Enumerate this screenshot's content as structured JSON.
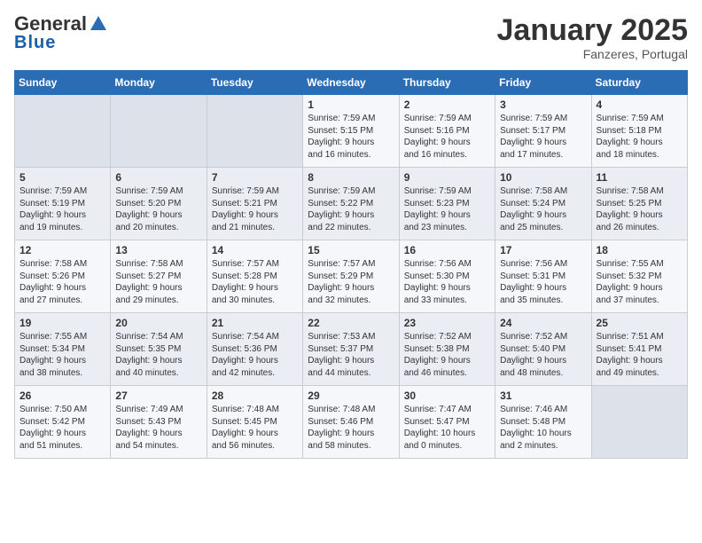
{
  "header": {
    "logo_general": "General",
    "logo_blue": "Blue",
    "month": "January 2025",
    "location": "Fanzeres, Portugal"
  },
  "weekdays": [
    "Sunday",
    "Monday",
    "Tuesday",
    "Wednesday",
    "Thursday",
    "Friday",
    "Saturday"
  ],
  "weeks": [
    [
      {
        "day": "",
        "info": ""
      },
      {
        "day": "",
        "info": ""
      },
      {
        "day": "",
        "info": ""
      },
      {
        "day": "1",
        "info": "Sunrise: 7:59 AM\nSunset: 5:15 PM\nDaylight: 9 hours\nand 16 minutes."
      },
      {
        "day": "2",
        "info": "Sunrise: 7:59 AM\nSunset: 5:16 PM\nDaylight: 9 hours\nand 16 minutes."
      },
      {
        "day": "3",
        "info": "Sunrise: 7:59 AM\nSunset: 5:17 PM\nDaylight: 9 hours\nand 17 minutes."
      },
      {
        "day": "4",
        "info": "Sunrise: 7:59 AM\nSunset: 5:18 PM\nDaylight: 9 hours\nand 18 minutes."
      }
    ],
    [
      {
        "day": "5",
        "info": "Sunrise: 7:59 AM\nSunset: 5:19 PM\nDaylight: 9 hours\nand 19 minutes."
      },
      {
        "day": "6",
        "info": "Sunrise: 7:59 AM\nSunset: 5:20 PM\nDaylight: 9 hours\nand 20 minutes."
      },
      {
        "day": "7",
        "info": "Sunrise: 7:59 AM\nSunset: 5:21 PM\nDaylight: 9 hours\nand 21 minutes."
      },
      {
        "day": "8",
        "info": "Sunrise: 7:59 AM\nSunset: 5:22 PM\nDaylight: 9 hours\nand 22 minutes."
      },
      {
        "day": "9",
        "info": "Sunrise: 7:59 AM\nSunset: 5:23 PM\nDaylight: 9 hours\nand 23 minutes."
      },
      {
        "day": "10",
        "info": "Sunrise: 7:58 AM\nSunset: 5:24 PM\nDaylight: 9 hours\nand 25 minutes."
      },
      {
        "day": "11",
        "info": "Sunrise: 7:58 AM\nSunset: 5:25 PM\nDaylight: 9 hours\nand 26 minutes."
      }
    ],
    [
      {
        "day": "12",
        "info": "Sunrise: 7:58 AM\nSunset: 5:26 PM\nDaylight: 9 hours\nand 27 minutes."
      },
      {
        "day": "13",
        "info": "Sunrise: 7:58 AM\nSunset: 5:27 PM\nDaylight: 9 hours\nand 29 minutes."
      },
      {
        "day": "14",
        "info": "Sunrise: 7:57 AM\nSunset: 5:28 PM\nDaylight: 9 hours\nand 30 minutes."
      },
      {
        "day": "15",
        "info": "Sunrise: 7:57 AM\nSunset: 5:29 PM\nDaylight: 9 hours\nand 32 minutes."
      },
      {
        "day": "16",
        "info": "Sunrise: 7:56 AM\nSunset: 5:30 PM\nDaylight: 9 hours\nand 33 minutes."
      },
      {
        "day": "17",
        "info": "Sunrise: 7:56 AM\nSunset: 5:31 PM\nDaylight: 9 hours\nand 35 minutes."
      },
      {
        "day": "18",
        "info": "Sunrise: 7:55 AM\nSunset: 5:32 PM\nDaylight: 9 hours\nand 37 minutes."
      }
    ],
    [
      {
        "day": "19",
        "info": "Sunrise: 7:55 AM\nSunset: 5:34 PM\nDaylight: 9 hours\nand 38 minutes."
      },
      {
        "day": "20",
        "info": "Sunrise: 7:54 AM\nSunset: 5:35 PM\nDaylight: 9 hours\nand 40 minutes."
      },
      {
        "day": "21",
        "info": "Sunrise: 7:54 AM\nSunset: 5:36 PM\nDaylight: 9 hours\nand 42 minutes."
      },
      {
        "day": "22",
        "info": "Sunrise: 7:53 AM\nSunset: 5:37 PM\nDaylight: 9 hours\nand 44 minutes."
      },
      {
        "day": "23",
        "info": "Sunrise: 7:52 AM\nSunset: 5:38 PM\nDaylight: 9 hours\nand 46 minutes."
      },
      {
        "day": "24",
        "info": "Sunrise: 7:52 AM\nSunset: 5:40 PM\nDaylight: 9 hours\nand 48 minutes."
      },
      {
        "day": "25",
        "info": "Sunrise: 7:51 AM\nSunset: 5:41 PM\nDaylight: 9 hours\nand 49 minutes."
      }
    ],
    [
      {
        "day": "26",
        "info": "Sunrise: 7:50 AM\nSunset: 5:42 PM\nDaylight: 9 hours\nand 51 minutes."
      },
      {
        "day": "27",
        "info": "Sunrise: 7:49 AM\nSunset: 5:43 PM\nDaylight: 9 hours\nand 54 minutes."
      },
      {
        "day": "28",
        "info": "Sunrise: 7:48 AM\nSunset: 5:45 PM\nDaylight: 9 hours\nand 56 minutes."
      },
      {
        "day": "29",
        "info": "Sunrise: 7:48 AM\nSunset: 5:46 PM\nDaylight: 9 hours\nand 58 minutes."
      },
      {
        "day": "30",
        "info": "Sunrise: 7:47 AM\nSunset: 5:47 PM\nDaylight: 10 hours\nand 0 minutes."
      },
      {
        "day": "31",
        "info": "Sunrise: 7:46 AM\nSunset: 5:48 PM\nDaylight: 10 hours\nand 2 minutes."
      },
      {
        "day": "",
        "info": ""
      }
    ]
  ]
}
